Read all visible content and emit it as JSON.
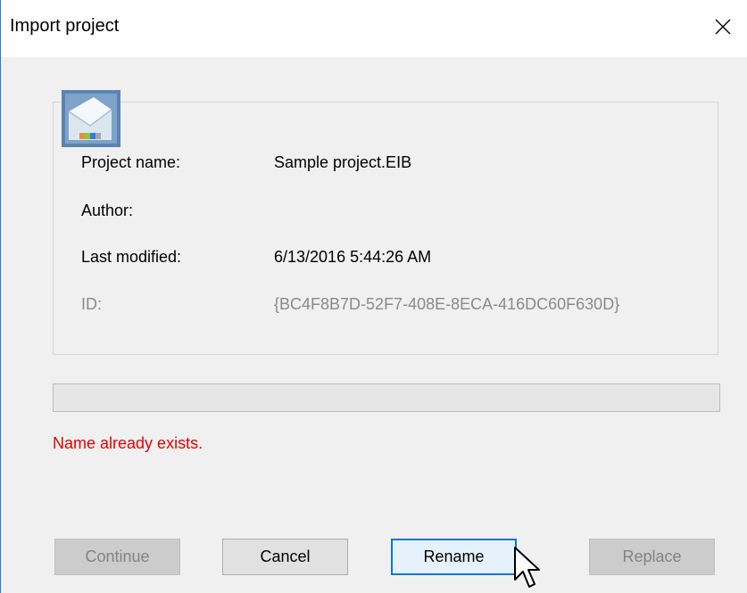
{
  "window": {
    "title": "Import project",
    "close_glyph": "close-icon"
  },
  "project": {
    "icon": "project-file-icon",
    "fields": [
      {
        "label": "Project name:",
        "value": "Sample project.EIB",
        "muted": false
      },
      {
        "label": "Author:",
        "value": "",
        "muted": false
      },
      {
        "label": "Last modified:",
        "value": "6/13/2016 5:44:26 AM",
        "muted": false
      },
      {
        "label": "ID:",
        "value": "{BC4F8B7D-52F7-408E-8ECA-416DC60F630D}",
        "muted": true
      }
    ]
  },
  "progress": {
    "value": 0
  },
  "status": {
    "message": "Name already exists.",
    "color": "#e50000"
  },
  "buttons": {
    "continue": {
      "label": "Continue",
      "enabled": false
    },
    "cancel": {
      "label": "Cancel",
      "enabled": true
    },
    "rename": {
      "label": "Rename",
      "enabled": true,
      "focused": true
    },
    "replace": {
      "label": "Replace",
      "enabled": false
    }
  },
  "colors": {
    "accent": "#0078d7",
    "error": "#e50000",
    "disabled_text": "#838383"
  }
}
